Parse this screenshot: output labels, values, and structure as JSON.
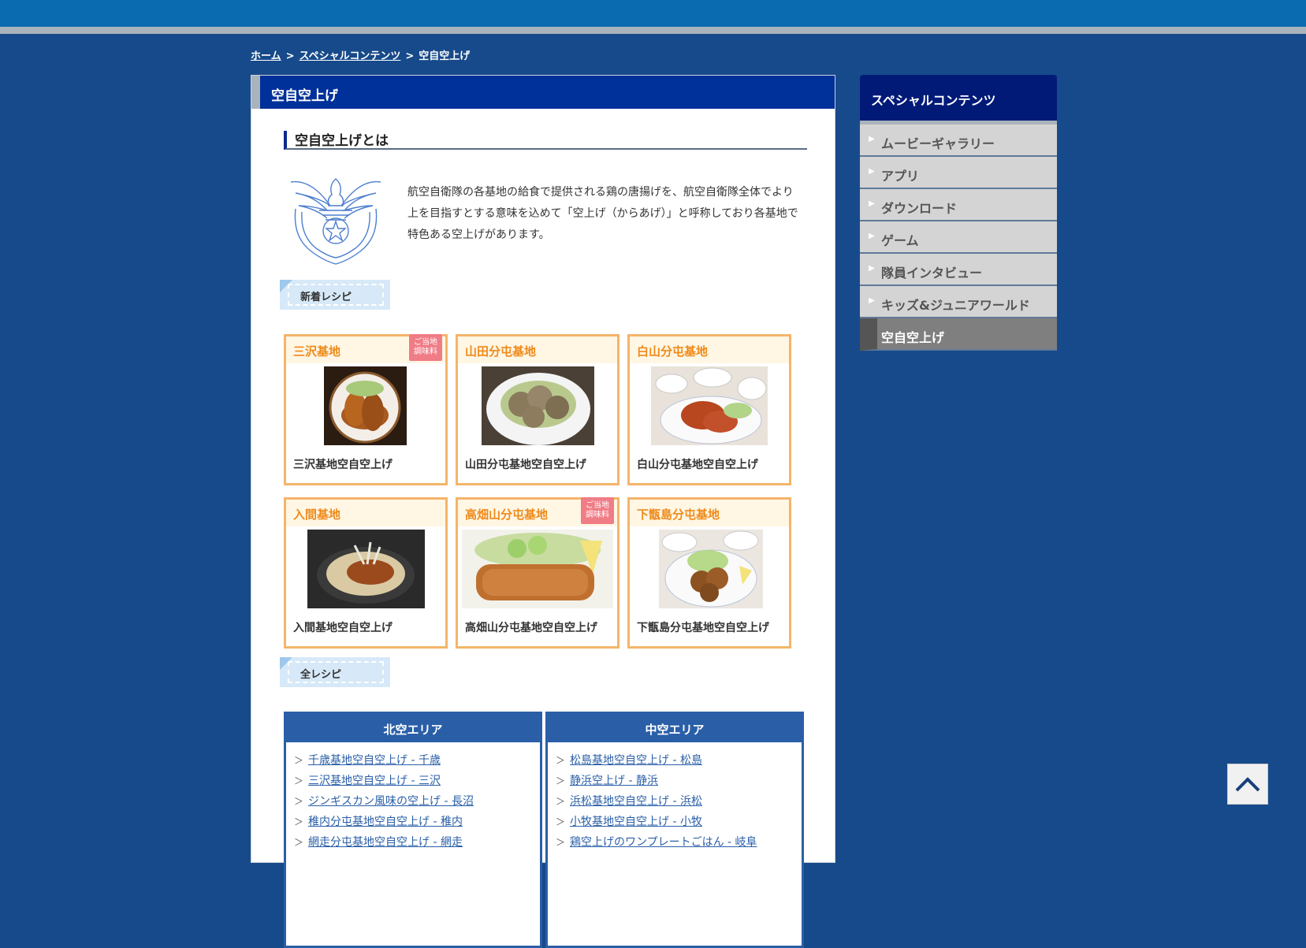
{
  "breadcrumb": {
    "home": "ホーム",
    "sep1": ">",
    "special": "スペシャルコンテンツ",
    "sep2": ">",
    "current": "空自空上げ"
  },
  "main": {
    "title": "空自空上げ",
    "section_title": "空自空上げとは",
    "intro": "航空自衛隊の各基地の給食で提供される鶏の唐揚げを、航空自衛隊全体でより上を目指すとする意味を込めて「空上げ（からあげ）」と呼称しており各基地で特色ある空上げがあります。",
    "new_tag": "新着レシピ",
    "all_tag": "全レシピ"
  },
  "cards": [
    {
      "title": "三沢基地",
      "caption": "三沢基地空自空上げ",
      "badge": "ご当地調味料",
      "img": "fried-chicken-wings-plate"
    },
    {
      "title": "山田分屯基地",
      "caption": "山田分屯基地空自空上げ",
      "badge": "",
      "img": "fried-chicken-salad-plate"
    },
    {
      "title": "白山分屯基地",
      "caption": "白山分屯基地空自空上げ",
      "badge": "",
      "img": "fried-chicken-meal-set"
    },
    {
      "title": "入間基地",
      "caption": "入間基地空自空上げ",
      "badge": "",
      "img": "fried-chicken-rice-bowl"
    },
    {
      "title": "高畑山分屯基地",
      "caption": "高畑山分屯基地空自空上げ",
      "badge": "ご当地調味料",
      "img": "fried-chicken-cutlet"
    },
    {
      "title": "下甑島分屯基地",
      "caption": "下甑島分屯基地空自空上げ",
      "badge": "",
      "img": "fried-chicken-lemon-plate"
    }
  ],
  "areas": [
    {
      "title": "北空エリア",
      "items": [
        "千歳基地空自空上げ - 千歳",
        "三沢基地空自空上げ - 三沢",
        "ジンギスカン風味の空上げ - 長沼",
        "稚内分屯基地空自空上げ - 稚内",
        "網走分屯基地空自空上げ - 網走"
      ]
    },
    {
      "title": "中空エリア",
      "items": [
        "松島基地空自空上げ - 松島",
        "静浜空上げ - 静浜",
        "浜松基地空自空上げ - 浜松",
        "小牧基地空自空上げ - 小牧",
        "鶏空上げのワンプレートごはん - 岐阜"
      ]
    }
  ],
  "sidebar": {
    "title": "スペシャルコンテンツ",
    "items": [
      "ムービーギャラリー",
      "アプリ",
      "ダウンロード",
      "ゲーム",
      "隊員インタビュー",
      "キッズ&ジュニアワールド",
      "空自空上げ"
    ],
    "active_index": 6
  },
  "to_top_icon": "chevron-up-icon",
  "colors": {
    "page_bg": "#174a8a",
    "header_bar": "#0b6bb0",
    "main_head": "#00309a",
    "card_border": "#f4b56a",
    "card_title": "#ef8a1a",
    "area_blue": "#2a5fa8",
    "badge": "#f07c86"
  }
}
